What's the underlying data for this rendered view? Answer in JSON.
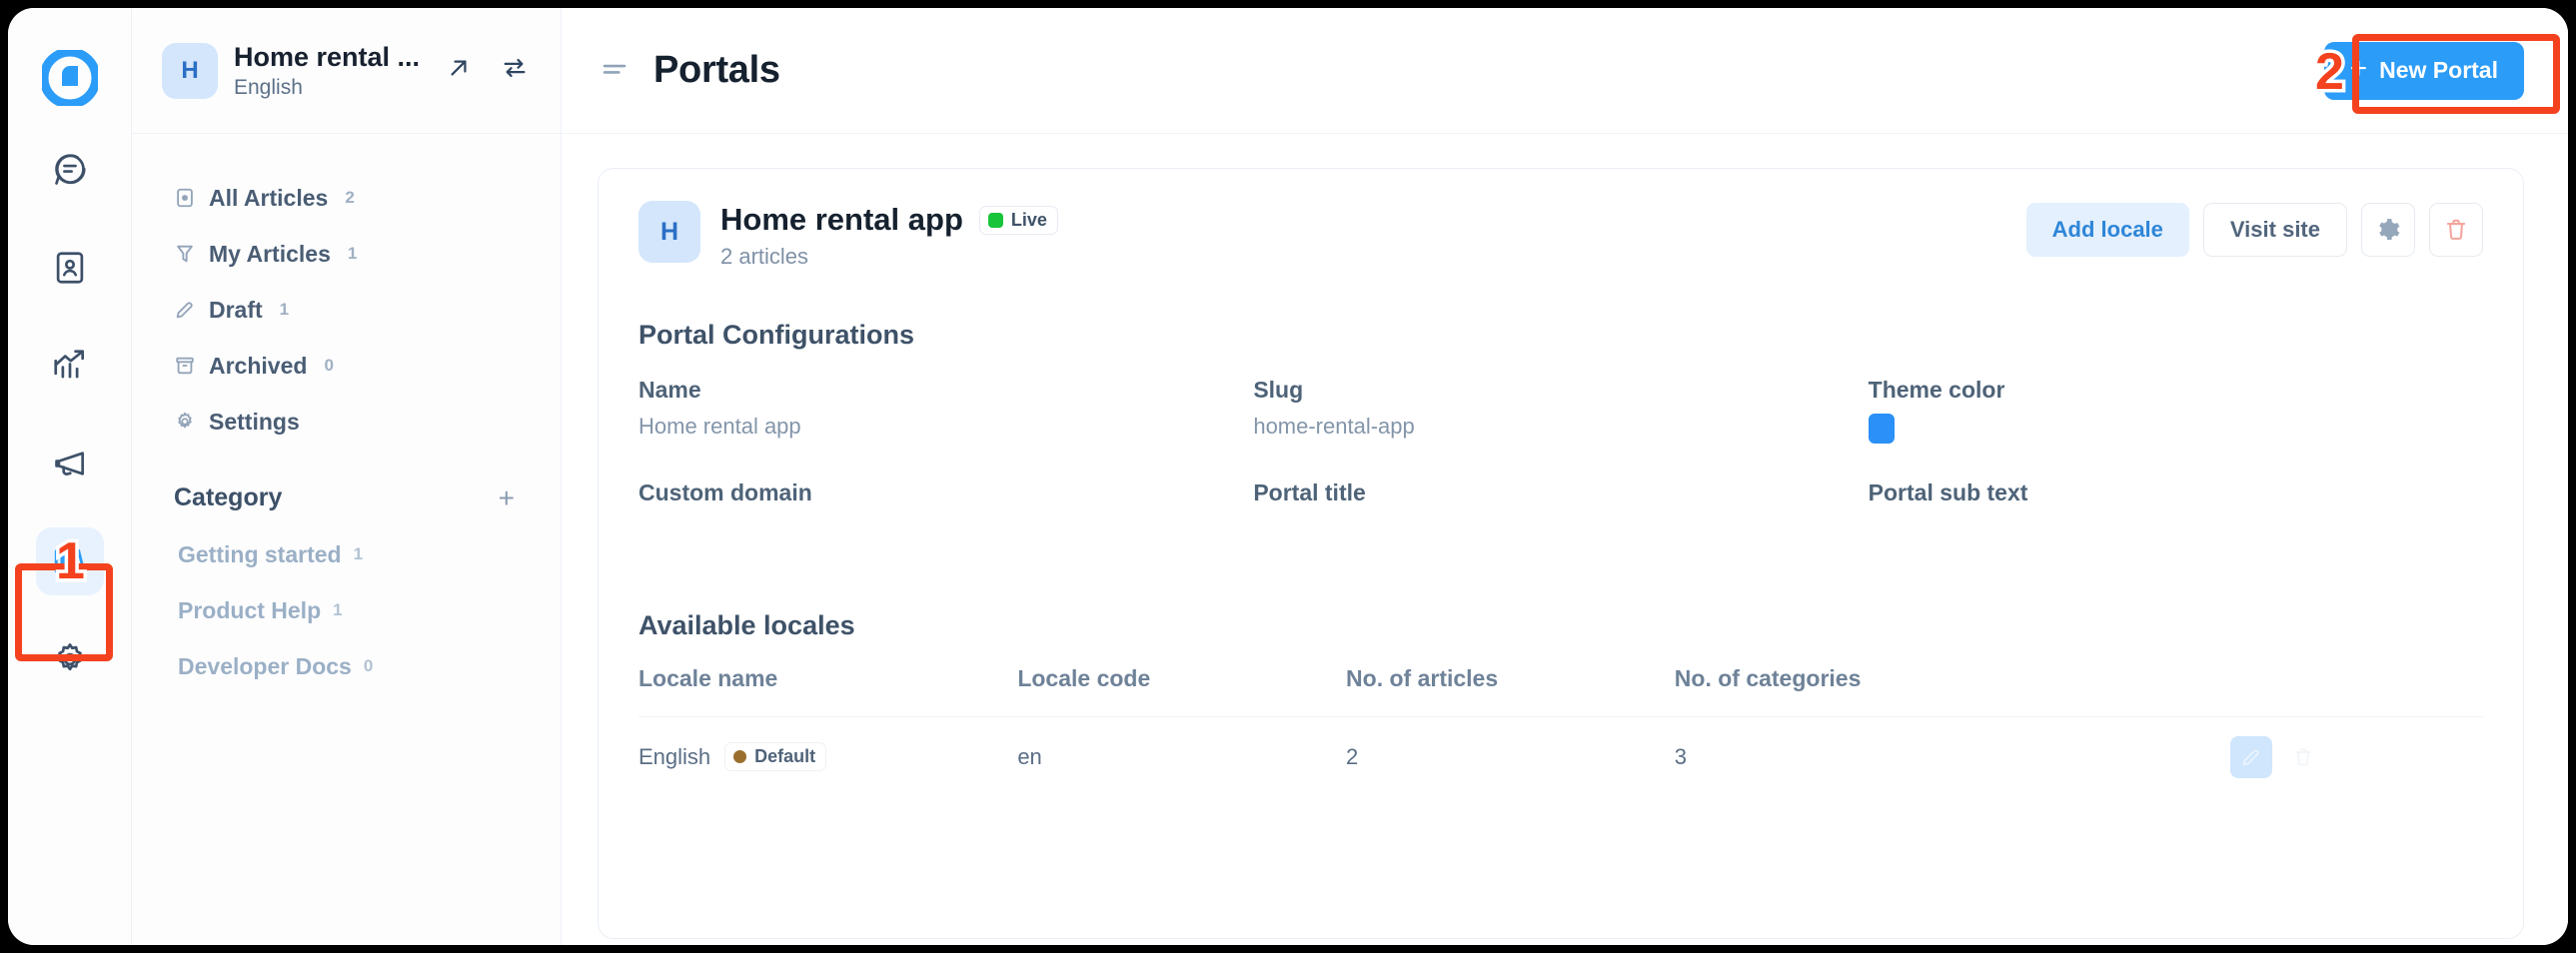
{
  "rail": {
    "logo_name": "app-logo",
    "items": [
      {
        "icon": "chat-bubble-icon",
        "name": "conversations",
        "active": false
      },
      {
        "icon": "contacts-icon",
        "name": "contacts",
        "active": false
      },
      {
        "icon": "reports-icon",
        "name": "reports",
        "active": false
      },
      {
        "icon": "campaigns-icon",
        "name": "campaigns",
        "active": false
      },
      {
        "icon": "books-icon",
        "name": "help-center",
        "active": true
      },
      {
        "icon": "gear-icon",
        "name": "settings",
        "active": false
      }
    ]
  },
  "sidebar": {
    "switcher": {
      "avatar_letter": "H",
      "title": "Home rental ...",
      "subtitle": "English",
      "open_icon": "arrow-up-right-icon",
      "swap_icon": "swap-arrows-icon"
    },
    "nav_items": [
      {
        "label": "All Articles",
        "count": "2",
        "icon": "document-icon"
      },
      {
        "label": "My Articles",
        "count": "1",
        "icon": "funnel-icon"
      },
      {
        "label": "Draft",
        "count": "1",
        "icon": "pencil-icon"
      },
      {
        "label": "Archived",
        "count": "0",
        "icon": "archive-icon"
      },
      {
        "label": "Settings",
        "count": "",
        "icon": "gear-icon"
      }
    ],
    "category": {
      "title": "Category",
      "add_label": "+",
      "items": [
        {
          "label": "Getting started",
          "count": "1"
        },
        {
          "label": "Product Help",
          "count": "1"
        },
        {
          "label": "Developer Docs",
          "count": "0"
        }
      ]
    }
  },
  "topbar": {
    "menu_icon": "hamburger-icon",
    "title": "Portals",
    "new_portal_plus": "+",
    "new_portal_label": "New Portal"
  },
  "portal_card": {
    "avatar_letter": "H",
    "title": "Home rental app",
    "status_badge": "Live",
    "status_color": "#18c43a",
    "subtitle": "2 articles",
    "actions": {
      "add_locale": "Add locale",
      "visit_site": "Visit site",
      "settings_icon": "gear-icon",
      "delete_icon": "trash-icon"
    },
    "config": {
      "section_title": "Portal Configurations",
      "fields": [
        {
          "label": "Name",
          "value": "Home rental app"
        },
        {
          "label": "Slug",
          "value": "home-rental-app"
        },
        {
          "label": "Theme color",
          "value": "",
          "swatch": "#2b90f8"
        },
        {
          "label": "Custom domain",
          "value": ""
        },
        {
          "label": "Portal title",
          "value": ""
        },
        {
          "label": "Portal sub text",
          "value": ""
        }
      ]
    },
    "locales": {
      "section_title": "Available locales",
      "columns": [
        "Locale name",
        "Locale code",
        "No. of articles",
        "No. of categories",
        ""
      ],
      "rows": [
        {
          "name": "English",
          "badge": "Default",
          "badge_dot_color": "#9a6f2e",
          "code": "en",
          "articles": "2",
          "categories": "3",
          "edit_icon": "pencil-icon",
          "delete_icon": "trash-icon"
        }
      ]
    }
  },
  "annotations": {
    "step1": "1",
    "step2": "2",
    "color": "#f4421e"
  }
}
